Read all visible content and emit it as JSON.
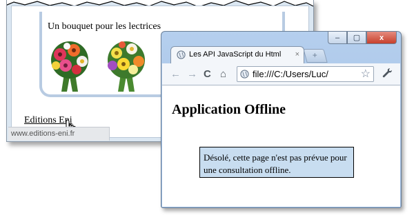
{
  "background_window": {
    "bouquet_caption": "Un bouquet pour les lectrices",
    "link_text": "Editions Eni",
    "status_url": "www.editions-eni.fr"
  },
  "browser": {
    "tab_title": "Les API JavaScript du Html",
    "tab_close": "×",
    "new_tab": "+",
    "address": "file:///C:/Users/Luc/",
    "window_buttons": {
      "minimize": "–",
      "maximize": "▢",
      "close": "x"
    },
    "nav": {
      "back": "←",
      "forward": "→",
      "reload": "C",
      "home": "⌂",
      "star": "☆",
      "wrench": "🔧"
    }
  },
  "page": {
    "heading": "Application Offline",
    "message": "Désolé, cette page n'est pas prévue pour une consultation offline."
  },
  "colors": {
    "message_background": "#c8ddf0",
    "window_frame": "#a7c3e6",
    "close_button": "#c7402c"
  },
  "icons": [
    "chrome-page-icon",
    "back-arrow-icon",
    "forward-arrow-icon",
    "reload-icon",
    "home-icon",
    "bookmark-star-icon",
    "wrench-icon",
    "hand-cursor-icon",
    "flower-bouquet-image"
  ]
}
